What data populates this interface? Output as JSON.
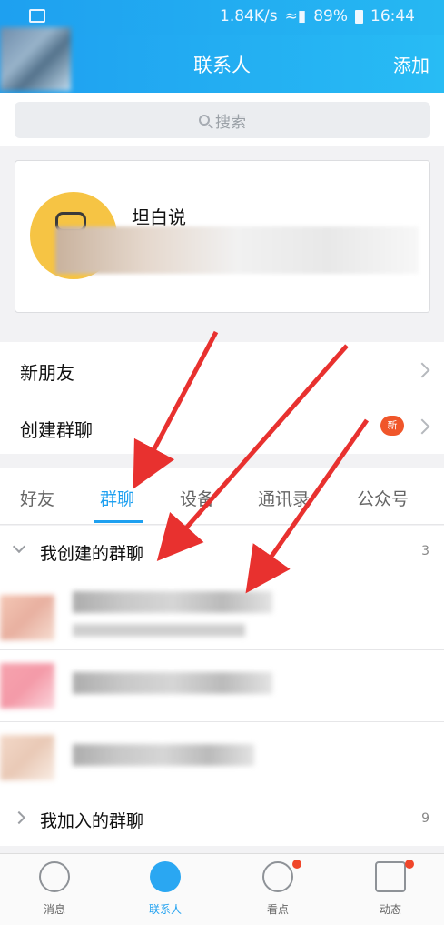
{
  "status_bar": {
    "network_speed": "1.84K/s",
    "battery": "89%",
    "time": "16:44"
  },
  "header": {
    "title": "联系人",
    "add_label": "添加"
  },
  "search": {
    "placeholder": "搜索"
  },
  "featured": {
    "name": "坦白说"
  },
  "rows": [
    {
      "label": "新朋友",
      "badge": ""
    },
    {
      "label": "创建群聊",
      "badge": "新"
    }
  ],
  "tabs": [
    "好友",
    "群聊",
    "设备",
    "通讯录",
    "公众号"
  ],
  "active_tab": "群聊",
  "groups": [
    {
      "title": "我创建的群聊",
      "count": "3",
      "expanded": true
    },
    {
      "title": "我加入的群聊",
      "count": "9",
      "expanded": false
    }
  ],
  "tabbar": [
    {
      "label": "消息",
      "icon": "smile-icon"
    },
    {
      "label": "联系人",
      "icon": "contacts-icon",
      "active": true
    },
    {
      "label": "看点",
      "icon": "eye-icon"
    },
    {
      "label": "动态",
      "icon": "star-icon"
    }
  ],
  "colors": {
    "accent": "#1ea0f0",
    "badge": "#f0562a",
    "annotation_arrow": "#e8312f"
  }
}
